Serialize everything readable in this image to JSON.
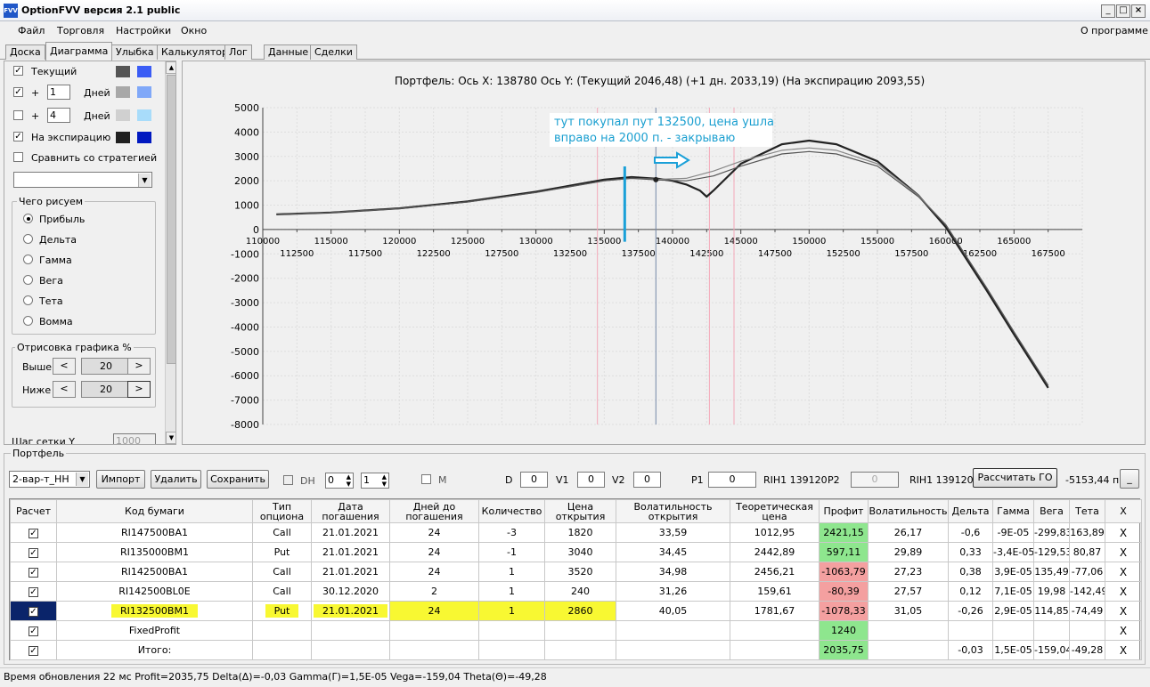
{
  "window": {
    "title": "OptionFVV версия 2.1 public",
    "icon_label": "FVV"
  },
  "menu": {
    "items": [
      "Файл",
      "Торговля",
      "Настройки",
      "Окно"
    ],
    "about": "О программе"
  },
  "tabs": [
    "Доска",
    "Диаграмма",
    "Улыбка",
    "Калькулятор",
    "Лог",
    "Данные",
    "Сделки"
  ],
  "left_panel": {
    "current_label": "Текущий",
    "plus": "+",
    "days_label": "Дней",
    "days1": "1",
    "days2": "4",
    "expiry_label": "На экспирацию",
    "compare_label": "Сравнить со стратегией",
    "what_draw_title": "Чего рисуем",
    "what_draw_options": [
      "Прибыль",
      "Дельта",
      "Гамма",
      "Вега",
      "Тета",
      "Вомма"
    ],
    "draw_pct_title": "Отрисовка графика %",
    "above_label": "Выше",
    "below_label": "Ниже",
    "above_value": "20",
    "below_value": "20",
    "prev": "<",
    "next": ">",
    "grid_step_label": "Шаг сетки Y",
    "grid_step_value": "1000",
    "colors": {
      "current": [
        "#555555",
        "#3a5cf5"
      ],
      "plus1": [
        "#a8a8a8",
        "#80a8f8"
      ],
      "plus4": [
        "#d0d0d0",
        "#a8dcfa"
      ],
      "expiry": [
        "#202020",
        "#0018c0"
      ]
    }
  },
  "chart": {
    "header": "Портфель: Ось X: 138780 Ось Y:  (Текущий 2046,48)  (+1 дн. 2033,19)  (На экспирацию 2093,55)",
    "annotation_line1": "тут покупал пут 132500, цена ушла",
    "annotation_line2": "вправо на 2000 п. - закрываю"
  },
  "chart_data": {
    "type": "line",
    "xlim": [
      110000,
      170000
    ],
    "ylim": [
      -8000,
      5000
    ],
    "x_ticks_upper": [
      110000,
      115000,
      120000,
      125000,
      130000,
      135000,
      140000,
      145000,
      150000,
      155000,
      160000,
      165000
    ],
    "x_ticks_lower": [
      112500,
      117500,
      122500,
      127500,
      132500,
      137500,
      142500,
      147500,
      152500,
      157500,
      162500,
      167500
    ],
    "y_ticks": [
      5000,
      4000,
      3000,
      2000,
      1000,
      0,
      -1000,
      -2000,
      -3000,
      -4000,
      -5000,
      -6000,
      -7000,
      -8000
    ],
    "vertical_lines": {
      "current_price": 138780,
      "pink_lines": [
        134500,
        142700,
        144500
      ],
      "annotation_marker": 136500
    },
    "current_point": {
      "x": 138780,
      "y": 2046
    },
    "series": [
      {
        "x": [
          111000,
          115000,
          120000,
          125000,
          130000,
          135000,
          137000,
          139000,
          140000,
          141000,
          142000,
          142500,
          143000,
          145000,
          148000,
          150000,
          152000,
          155000,
          158000,
          160000,
          163000,
          165000,
          167500
        ],
        "y": [
          620,
          700,
          870,
          1150,
          1550,
          2050,
          2150,
          2080,
          2000,
          1850,
          1600,
          1350,
          1600,
          2700,
          3500,
          3650,
          3500,
          2800,
          1400,
          100,
          -2500,
          -4300,
          -6500
        ]
      },
      {
        "x": [
          111000,
          115000,
          120000,
          125000,
          130000,
          135000,
          137000,
          139000,
          141000,
          143000,
          145000,
          148000,
          150000,
          152000,
          155000,
          158000,
          160000,
          163000,
          165000,
          167500
        ],
        "y": [
          620,
          700,
          860,
          1130,
          1520,
          2000,
          2100,
          2060,
          2100,
          2400,
          2800,
          3250,
          3350,
          3250,
          2700,
          1400,
          200,
          -2400,
          -4200,
          -6400
        ]
      },
      {
        "x": [
          111000,
          115000,
          120000,
          125000,
          130000,
          135000,
          137000,
          139000,
          141000,
          143000,
          145000,
          148000,
          150000,
          152000,
          155000,
          158000,
          160000,
          163000,
          165000,
          167500
        ],
        "y": [
          620,
          700,
          860,
          1130,
          1520,
          2000,
          2100,
          2030,
          2000,
          2200,
          2600,
          3100,
          3200,
          3100,
          2600,
          1350,
          200,
          -2400,
          -4200,
          -6400
        ]
      }
    ]
  },
  "portfolio": {
    "title": "Портфель",
    "combo_value": "2-вар-т_HH",
    "import": "Импорт",
    "delete": "Удалить",
    "save": "Сохранить",
    "dh": "DH",
    "spin1": "0",
    "spin2": "1",
    "m": "M",
    "d_label": "D",
    "d_value": "0",
    "v1_label": "V1",
    "v1_value": "0",
    "v2_label": "V2",
    "v2_value": "0",
    "p1_label": "P1",
    "p1_value": "0",
    "rih1": "RIH1 139120",
    "p2_label": "P2",
    "p2_value": "0",
    "rih2": "RIH1 139120",
    "calc_go": "Рассчитать ГО",
    "go_value": "-5153,44 п.",
    "min_btn": "_"
  },
  "table": {
    "headers": [
      "Расчет",
      "Код бумаги",
      "Тип опциона",
      "Дата погашения",
      "Дней до погашения",
      "Количество",
      "Цена открытия",
      "Волатильность открытия",
      "Теоретическая цена",
      "Профит",
      "Волатильность",
      "Дельта",
      "Гамма",
      "Вега",
      "Тета",
      "X"
    ],
    "rows": [
      {
        "code": "RI147500BA1",
        "type": "Call",
        "date": "21.01.2021",
        "days": "24",
        "qty": "-3",
        "price": "1820",
        "vol_open": "33,59",
        "theor": "1012,95",
        "profit": "2421,15",
        "vol": "26,17",
        "delta": "-0,6",
        "gamma": "-9E-05",
        "vega": "-299,83",
        "theta": "163,89"
      },
      {
        "code": "RI135000BM1",
        "type": "Put",
        "date": "21.01.2021",
        "days": "24",
        "qty": "-1",
        "price": "3040",
        "vol_open": "34,45",
        "theor": "2442,89",
        "profit": "597,11",
        "vol": "29,89",
        "delta": "0,33",
        "gamma": "-3,4E-05",
        "vega": "-129,53",
        "theta": "80,87"
      },
      {
        "code": "RI142500BA1",
        "type": "Call",
        "date": "21.01.2021",
        "days": "24",
        "qty": "1",
        "price": "3520",
        "vol_open": "34,98",
        "theor": "2456,21",
        "profit": "-1063,79",
        "vol": "27,23",
        "delta": "0,38",
        "gamma": "3,9E-05",
        "vega": "135,49",
        "theta": "-77,06"
      },
      {
        "code": "RI142500BL0E",
        "type": "Call",
        "date": "30.12.2020",
        "days": "2",
        "qty": "1",
        "price": "240",
        "vol_open": "31,26",
        "theor": "159,61",
        "profit": "-80,39",
        "vol": "27,57",
        "delta": "0,12",
        "gamma": "7,1E-05",
        "vega": "19,98",
        "theta": "-142,49"
      },
      {
        "code": "RI132500BM1",
        "type": "Put",
        "date": "21.01.2021",
        "days": "24",
        "qty": "1",
        "price": "2860",
        "vol_open": "40,05",
        "theor": "1781,67",
        "profit": "-1078,33",
        "vol": "31,05",
        "delta": "-0,26",
        "gamma": "2,9E-05",
        "vega": "114,85",
        "theta": "-74,49"
      }
    ],
    "fixed_label": "FixedProfit",
    "fixed_profit": "1240",
    "total_label": "Итого:",
    "total_profit": "2035,75",
    "total_delta": "-0,03",
    "total_gamma": "1,5E-05",
    "total_vega": "-159,04",
    "total_theta": "-49,28",
    "check": "✓",
    "close": "X"
  },
  "status": "Время обновления 22 мс  Profit=2035,75 Delta(Δ)=-0,03 Gamma(Γ)=1,5E-05 Vega=-159,04 Theta(Θ)=-49,28"
}
